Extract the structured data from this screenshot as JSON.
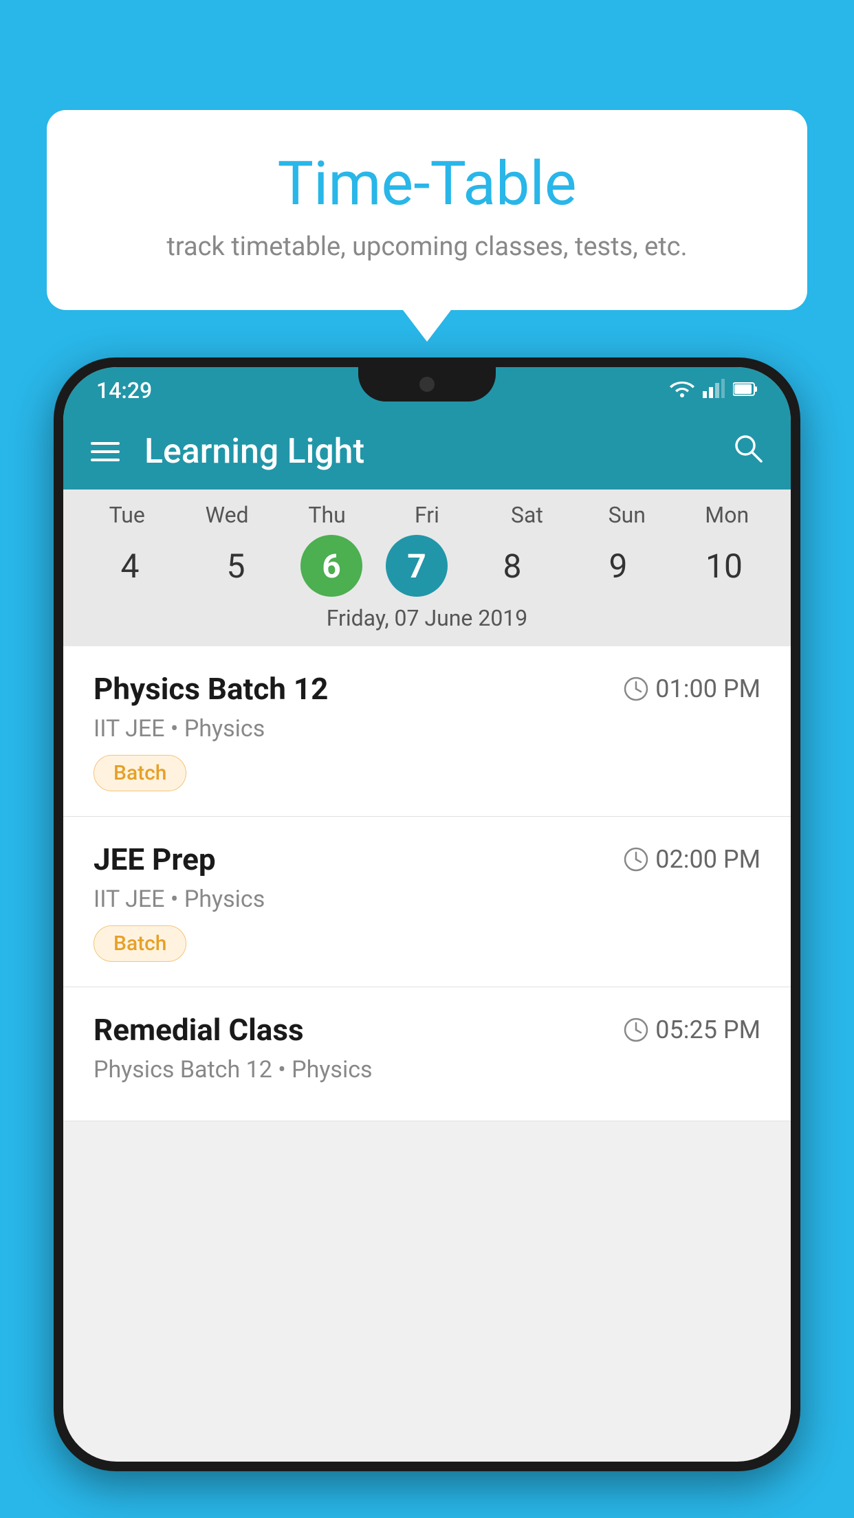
{
  "background": {
    "color": "#29B6E8"
  },
  "tooltip": {
    "title": "Time-Table",
    "subtitle": "track timetable, upcoming classes, tests, etc."
  },
  "phone": {
    "status_bar": {
      "time": "14:29"
    },
    "app_bar": {
      "title": "Learning Light"
    },
    "calendar": {
      "days": [
        {
          "label": "Tue",
          "num": "4"
        },
        {
          "label": "Wed",
          "num": "5"
        },
        {
          "label": "Thu",
          "num": "6",
          "state": "today"
        },
        {
          "label": "Fri",
          "num": "7",
          "state": "selected"
        },
        {
          "label": "Sat",
          "num": "8"
        },
        {
          "label": "Sun",
          "num": "9"
        },
        {
          "label": "Mon",
          "num": "10"
        }
      ],
      "selected_date_label": "Friday, 07 June 2019"
    },
    "schedule": [
      {
        "title": "Physics Batch 12",
        "time": "01:00 PM",
        "subtitle": "IIT JEE • Physics",
        "badge": "Batch"
      },
      {
        "title": "JEE Prep",
        "time": "02:00 PM",
        "subtitle": "IIT JEE • Physics",
        "badge": "Batch"
      },
      {
        "title": "Remedial Class",
        "time": "05:25 PM",
        "subtitle": "Physics Batch 12 • Physics",
        "badge": ""
      }
    ]
  }
}
